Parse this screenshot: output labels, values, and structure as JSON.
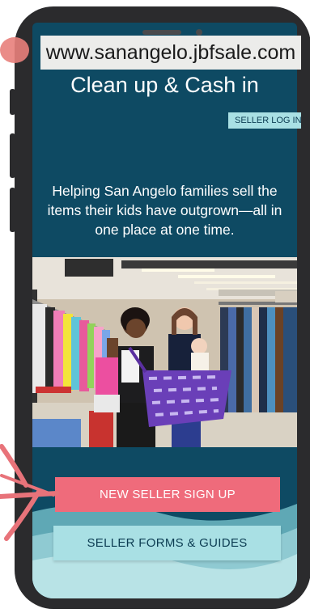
{
  "browser": {
    "url": "www.sanangelo.jbfsale.com"
  },
  "hero": {
    "headline": "Clean up & Cash in",
    "seller_login_label": "SELLER LOG IN",
    "tagline_line1": "Helping San Angelo families sell the",
    "tagline_line2": "items their kids have outgrown—all in",
    "tagline_line3": "one place at one time."
  },
  "cta": {
    "primary_label": "NEW SELLER SIGN UP",
    "secondary_label": "SELLER FORMS & GUIDES"
  },
  "colors": {
    "screen_bg": "#0e4a63",
    "primary_button": "#ef6b7b",
    "secondary_button": "#a9e0e4",
    "arrow": "#e8737a",
    "phone_frame": "#2b2b2d"
  },
  "icons": {
    "pointer": "hand-drawn-arrow-icon"
  }
}
